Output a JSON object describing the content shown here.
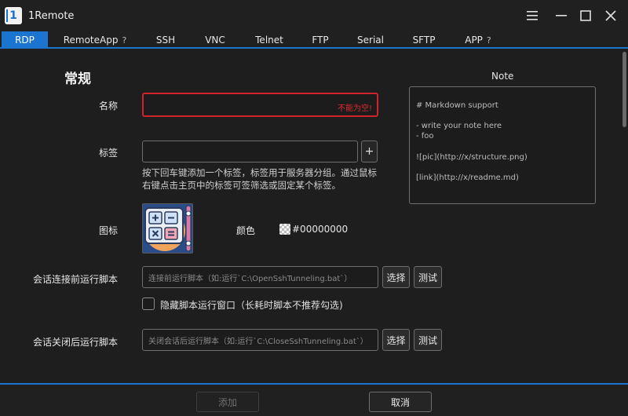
{
  "app": {
    "logo_text": "1",
    "title": "1Remote"
  },
  "window_controls": {
    "menu_icon": "hamburger-icon",
    "minimize_icon": "minimize-icon",
    "maximize_icon": "maximize-icon",
    "close_icon": "close-icon"
  },
  "tabs": [
    {
      "label": "RDP",
      "active": true
    },
    {
      "label": "RemoteApp",
      "help": "?"
    },
    {
      "label": "SSH"
    },
    {
      "label": "VNC"
    },
    {
      "label": "Telnet"
    },
    {
      "label": "FTP"
    },
    {
      "label": "Serial"
    },
    {
      "label": "SFTP"
    },
    {
      "label": "APP",
      "help": "?"
    }
  ],
  "form": {
    "section_title": "常规",
    "name": {
      "label": "名称",
      "value": "",
      "error": "不能为空!"
    },
    "tags": {
      "label": "标签",
      "value": "",
      "add_button": "+",
      "hint": "按下回车键添加一个标签，标签用于服务器分组。通过鼠标右键点击主页中的标签可签筛选或固定某个标签。"
    },
    "icon": {
      "label": "图标",
      "image": "calculator-icon"
    },
    "color": {
      "label": "颜色",
      "value": "#00000000"
    },
    "pre_script": {
      "label": "会话连接前运行脚本",
      "placeholder": "连接前运行脚本（如:运行`C:\\OpenSshTunneling.bat`）",
      "select_button": "选择",
      "test_button": "测试"
    },
    "hide_window": {
      "label": "隐藏脚本运行窗口（长耗时脚本不推荐勾选)",
      "checked": false
    },
    "post_script": {
      "label": "会话关闭后运行脚本",
      "placeholder": "关闭会话后运行脚本（如:运行`C:\\CloseSshTunneling.bat`）",
      "select_button": "选择",
      "test_button": "测试"
    }
  },
  "note": {
    "title": "Note",
    "lines": [
      "# Markdown support",
      "- write your note here",
      "- foo",
      "![pic](http://x/structure.png)",
      "[link](http://x/readme.md)"
    ]
  },
  "footer": {
    "add_button": "添加",
    "cancel_button": "取消"
  },
  "colors": {
    "accent": "#1a74d0",
    "error": "#d0232a",
    "background": "#1e1e1e"
  }
}
